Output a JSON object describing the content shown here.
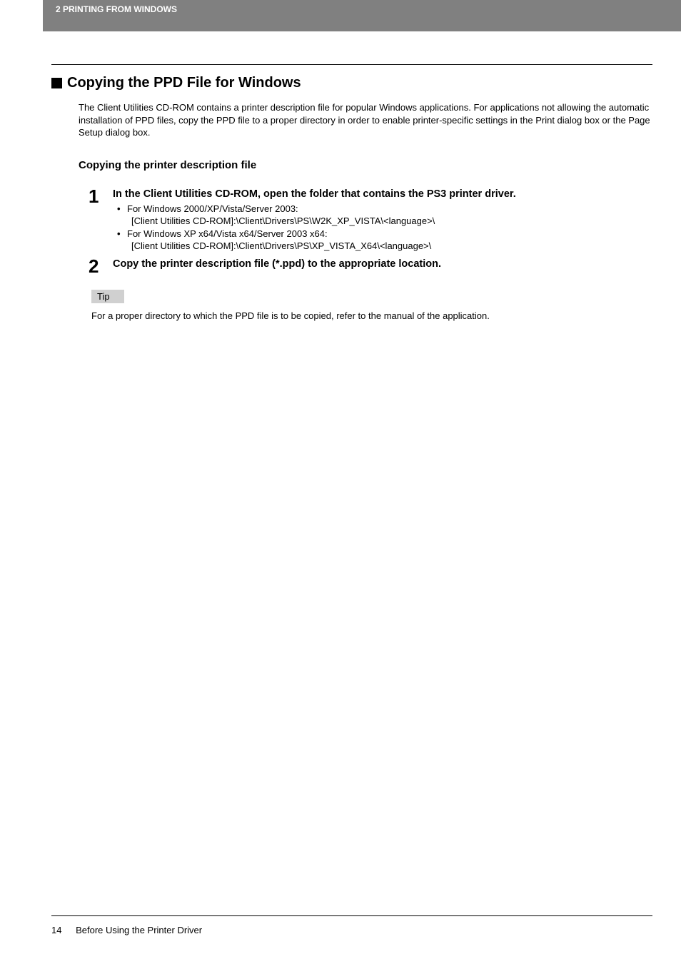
{
  "header": {
    "chapter": "2 PRINTING FROM WINDOWS"
  },
  "section": {
    "title": "Copying the PPD File for Windows",
    "intro": "The Client Utilities CD-ROM contains a printer description file for popular Windows applications. For applications not allowing the automatic installation of PPD files, copy the PPD file to a proper directory in order to enable printer-specific settings in the Print dialog box or the Page Setup dialog box."
  },
  "subheading": "Copying the printer description file",
  "steps": {
    "step1": {
      "number": "1",
      "title": "In the Client Utilities CD-ROM, open the folder that contains the PS3 printer driver.",
      "bullets": {
        "b1": "For Windows 2000/XP/Vista/Server 2003:",
        "b1path": "[Client Utilities CD-ROM]:\\Client\\Drivers\\PS\\W2K_XP_VISTA\\<language>\\",
        "b2": "For Windows XP x64/Vista x64/Server 2003 x64:",
        "b2path": "[Client Utilities CD-ROM]:\\Client\\Drivers\\PS\\XP_VISTA_X64\\<language>\\"
      }
    },
    "step2": {
      "number": "2",
      "title": "Copy the printer description file (*.ppd) to the appropriate location."
    }
  },
  "tip": {
    "label": "Tip",
    "text": "For a proper directory to which the PPD file is to be copied, refer to the manual of the application."
  },
  "footer": {
    "pageNumber": "14",
    "sectionName": "Before Using the Printer Driver"
  }
}
